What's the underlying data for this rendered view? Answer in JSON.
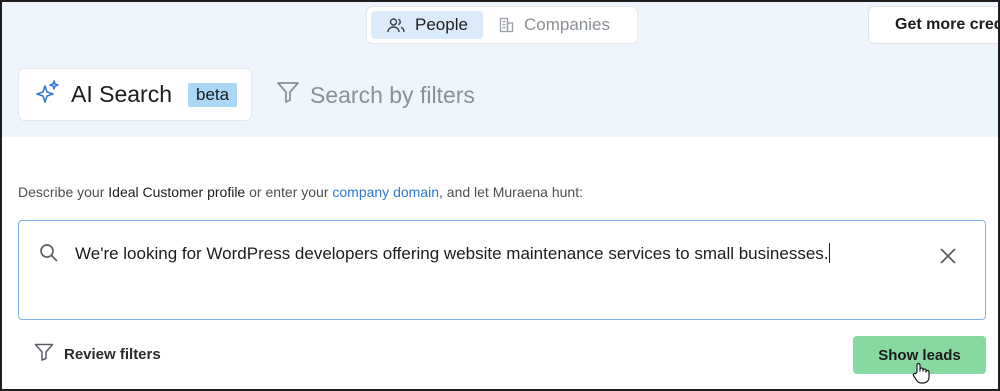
{
  "tabs": [
    {
      "label": "People",
      "icon": "people-icon",
      "active": true
    },
    {
      "label": "Companies",
      "icon": "building-icon",
      "active": false
    }
  ],
  "header": {
    "credits_label": "Get more credi"
  },
  "mode": {
    "ai_label": "AI Search",
    "beta_label": "beta",
    "filters_label": "Search by filters"
  },
  "description": {
    "part1": "Describe your ",
    "ideal_customer": "Ideal Customer profile",
    "part2": " or enter your ",
    "company_domain": "company domain",
    "part3": ", and let Muraena hunt:"
  },
  "search": {
    "value": "We're looking for WordPress developers offering website maintenance services to small businesses."
  },
  "actions": {
    "review_filters_label": "Review filters",
    "show_leads_label": "Show leads"
  },
  "colors": {
    "accent": "#2f79d1",
    "band": "#eef5fd",
    "show_leads_bg": "#88d8a2",
    "beta_bg": "#a9d7f5"
  }
}
